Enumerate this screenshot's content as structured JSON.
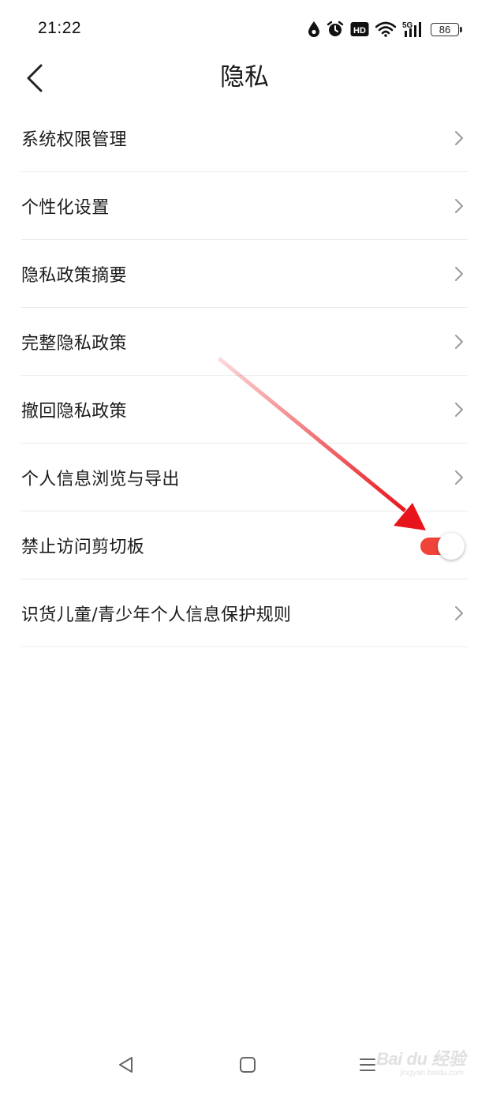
{
  "status_bar": {
    "time": "21:22",
    "network": "5G",
    "hd_label": "HD",
    "battery": "86",
    "icons": [
      "water-drop-icon",
      "alarm-icon",
      "hd-icon",
      "wifi-icon",
      "signal-icon",
      "battery-icon"
    ]
  },
  "header": {
    "title": "隐私",
    "back_icon": "chevron-left-icon"
  },
  "menu": {
    "items": [
      {
        "label": "系统权限管理",
        "control": "chevron"
      },
      {
        "label": "个性化设置",
        "control": "chevron"
      },
      {
        "label": "隐私政策摘要",
        "control": "chevron"
      },
      {
        "label": "完整隐私政策",
        "control": "chevron"
      },
      {
        "label": "撤回隐私政策",
        "control": "chevron"
      },
      {
        "label": "个人信息浏览与导出",
        "control": "chevron"
      },
      {
        "label": "禁止访问剪切板",
        "control": "toggle",
        "toggle_on": true
      },
      {
        "label": "识货儿童/青少年个人信息保护规则",
        "control": "chevron"
      }
    ]
  },
  "colors": {
    "toggle_on": "#f0443a",
    "annotation_arrow": "#e8141b",
    "divider": "#ececec"
  },
  "nav_bar": {
    "icons": [
      "back-triangle-icon",
      "home-square-icon",
      "menu-lines-icon"
    ]
  },
  "watermark": {
    "brand": "Bai du 经验",
    "sub": "jingyan.baidu.com"
  }
}
